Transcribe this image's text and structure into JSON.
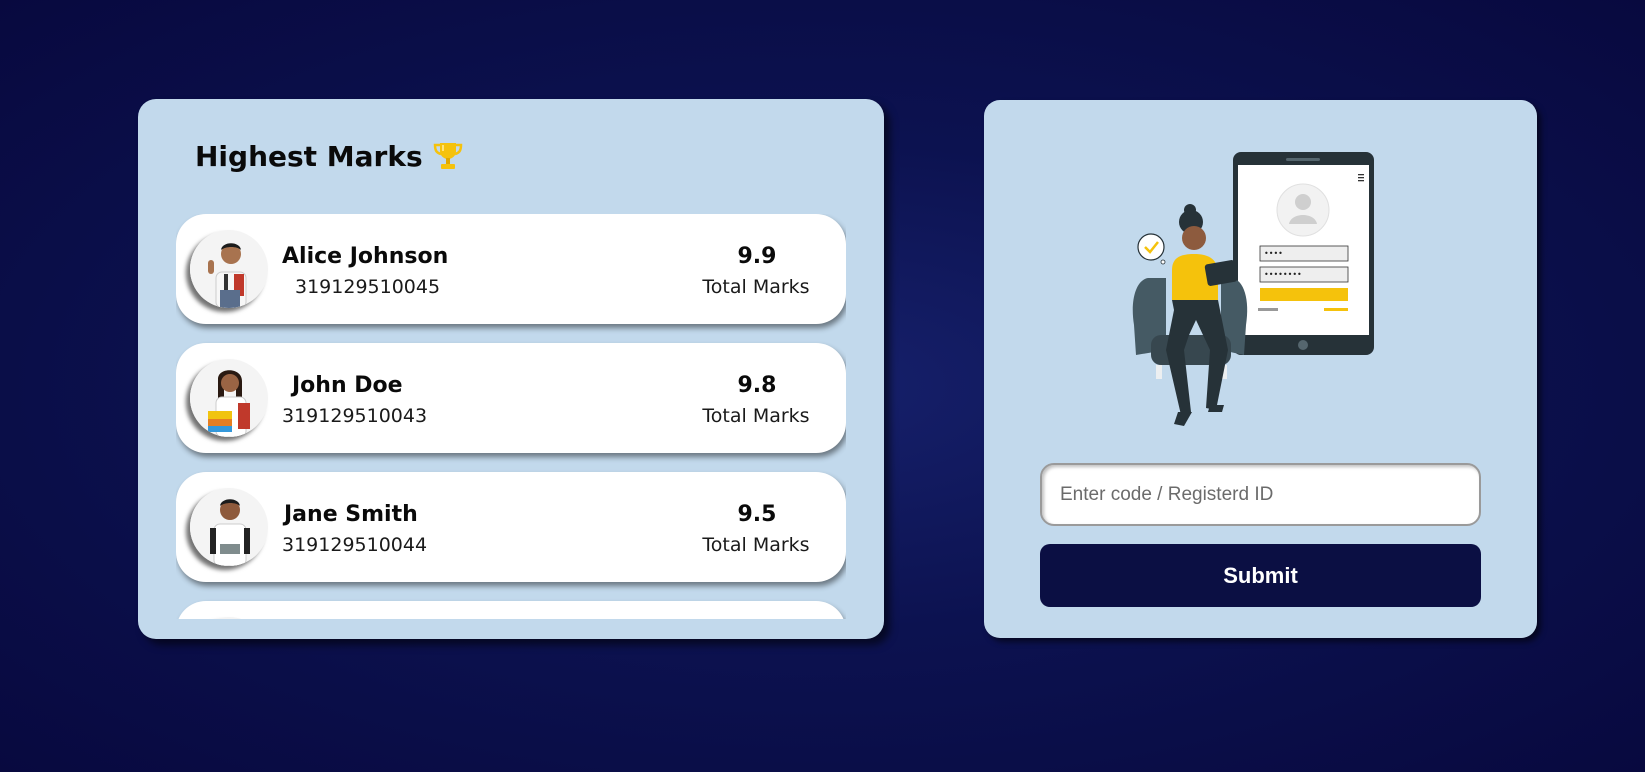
{
  "leaderboard": {
    "title": "Highest Marks",
    "trophy_icon": "trophy-icon",
    "students": [
      {
        "name": "Alice Johnson",
        "id": "319129510045",
        "marks": "9.9",
        "marks_label": "Total Marks"
      },
      {
        "name": "John Doe",
        "id": "319129510043",
        "marks": "9.8",
        "marks_label": "Total Marks"
      },
      {
        "name": "Jane Smith",
        "id": "319129510044",
        "marks": "9.5",
        "marks_label": "Total Marks"
      }
    ]
  },
  "login": {
    "illustration": "person-with-tablet-login-illustration",
    "input_placeholder": "Enter code / Registerd ID",
    "submit_label": "Submit"
  },
  "colors": {
    "page_background": "#0c1250",
    "card_background": "#c2d9ec",
    "row_background": "#ffffff",
    "button_background": "#0b0f43",
    "accent_yellow": "#f5c20c"
  }
}
